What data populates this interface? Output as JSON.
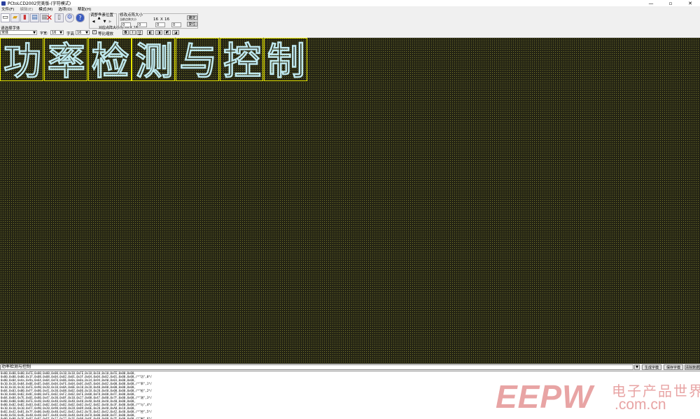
{
  "window": {
    "title": "PCtoLCD2002完美版-(字符模式)"
  },
  "menu": {
    "file": "文件(F)",
    "edit": "编辑(E)",
    "mode": "模式(M)",
    "options": "选项(O)",
    "help": "帮助(H)"
  },
  "toolbar": {
    "font_group_label": "请选择字体",
    "font_name": "宋体",
    "width_label": "字宽:",
    "width_value": "16",
    "height_label": "字高",
    "height_value": "16",
    "equal_ratio_label": "等比缩放",
    "bold_label": "B",
    "italic_label": "I",
    "underline_label": "U",
    "adjust_pos_label": "调整像素位置",
    "lattice_info": "对应点阵大小为 16 X 16",
    "modify_size_label": "修改点阵大小",
    "size_sub_label": "当前点阵大小",
    "size_a": "16",
    "size_x": "X",
    "size_b": "16",
    "field_1": "0",
    "field_2": "0",
    "field_3": "0",
    "field_4": "0",
    "ok_label": "确定",
    "reset_label": "复位"
  },
  "canvas": {
    "glyphs": [
      "功",
      "率",
      "检",
      "测",
      "与",
      "控",
      "制"
    ],
    "dot_color": "#7a7a2c",
    "glyph_color": "#bfe8ee",
    "cell_border_color": "#e8e800"
  },
  "input": {
    "text": "功率检测与控制"
  },
  "buttons": {
    "generate": "生成字模",
    "save": "保存字模",
    "clear": "清除数据"
  },
  "output": {
    "lines": [
      "0x00,0x00,0x00,0xFE,0x00,0x00,0x00,0x10,0x10,0xFE,0x10,0x10,0x10,0xFE,0x00,0x00,",
      "0x00,0x00,0x00,0x1F,0x08,0x08,0x04,0x02,0x01,0x3F,0x04,0x04,0x02,0x01,0x00,0x00,/*\"功\",0*/",
      "0x00,0x04,0xAa,0x9a,0x64,0x04,0xF0,0x06,0x0a,0x0a,0x34,0x94,0xA0,0x03,0x00,0x00,",
      "0x10,0x10,0x04,0x0E,0x05,0x04,0x04,0xFE,0x04,0x0C,0x05,0x04,0x02,0x00,0x00,0x00,/*\"率\",1*/",
      "0x10,0x10,0x10,0xFE,0x90,0x20,0x10,0x0A,0x0E,0x10,0x20,0x40,0x80,0x00,0x00,0x00,",
      "0x04,0x03,0x00,0xFF,0x00,0x41,0x30,0x08,0x02,0x06,0x18,0x20,0x40,0x00,0x00,0x00,/*\"检\",2*/",
      "0x10,0x60,0x02,0x8C,0x00,0xFE,0x02,0xF2,0x02,0xFE,0x00,0xF8,0x00,0xFF,0x00,0x00,",
      "0x04,0x04,0x7E,0x01,0x80,0x47,0x30,0x0F,0x10,0x27,0x00,0x47,0x80,0x7F,0x00,0x00,/*\"测\",3*/",
      "0x00,0x00,0x00,0xFE,0x40,0x40,0x40,0x40,0x40,0x40,0x40,0x40,0x40,0x40,0x00,0x00,",
      "0x00,0x02,0x02,0x03,0x02,0x02,0x02,0x02,0x02,0x02,0x42,0x82,0x40,0x3F,0x00,0x00,/*\"与\",4*/",
      "0x10,0x10,0x10,0xFF,0x90,0x20,0x98,0x48,0x28,0x09,0x0E,0x28,0x48,0xA8,0x18,0x00,",
      "0x02,0x42,0x81,0x7F,0x00,0x40,0x40,0x42,0x42,0x42,0x7E,0x42,0x42,0x42,0x40,0x00,/*\"控\",5*/",
      "0x40,0x50,0x4E,0x48,0x48,0xFF,0x48,0x48,0x48,0x40,0xF8,0x00,0x00,0xFF,0x00,0x00,",
      "0x00,0x00,0x3E,0x02,0x02,0xFF,0x12,0x22,0x1E,0x00,0x0F,0x40,0x80,0x7F,0x00,0x00,/*\"制\",6*/"
    ]
  },
  "watermark": {
    "brand": "EEPW",
    "cn": "电子产品世界",
    "domain": ".com.cn"
  }
}
